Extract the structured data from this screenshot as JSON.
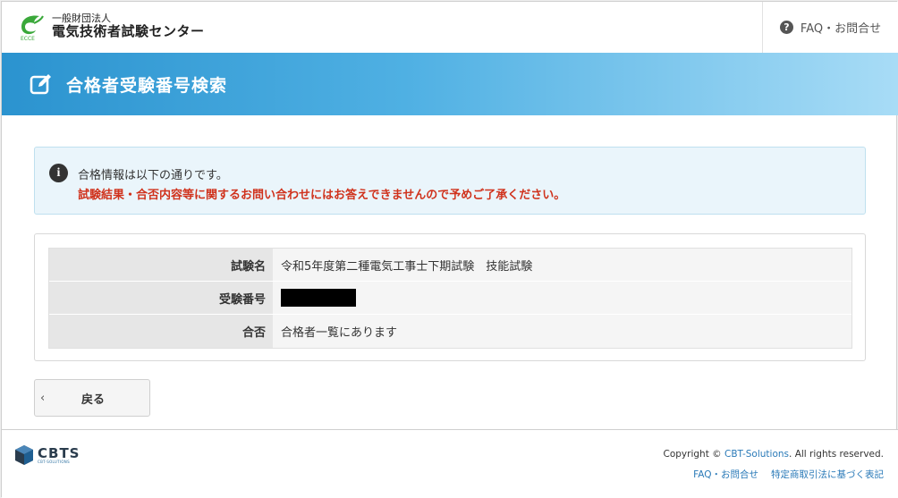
{
  "header": {
    "logo_small": "一般財団法人",
    "logo_main": "電気技術者試験センター",
    "faq_link": "FAQ・お問合せ",
    "brand_green": "#3aa83a"
  },
  "page": {
    "title": "合格者受験番号検索",
    "band_color": "#2b93cf"
  },
  "alert": {
    "info": "合格情報は以下の通りです。",
    "warning": "試験結果・合否内容等に関するお問い合わせにはお答えできませんので予めご了承ください。",
    "warning_color": "#d0321c"
  },
  "result": {
    "rows": [
      {
        "label": "試験名",
        "value": "令和5年度第二種電気工事士下期試験　技能試験"
      },
      {
        "label": "受験番号",
        "value": ""
      },
      {
        "label": "合否",
        "value": "合格者一覧にあります"
      }
    ]
  },
  "actions": {
    "back_label": "戻る"
  },
  "footer": {
    "brand": "CBTS",
    "brand_sub": "CBT-SOLUTIONS",
    "copyright_prefix": "Copyright © ",
    "copyright_link": "CBT-Solutions",
    "copyright_suffix": ". All rights reserved.",
    "links": [
      "FAQ・お問合せ",
      "特定商取引法に基づく表記"
    ]
  }
}
